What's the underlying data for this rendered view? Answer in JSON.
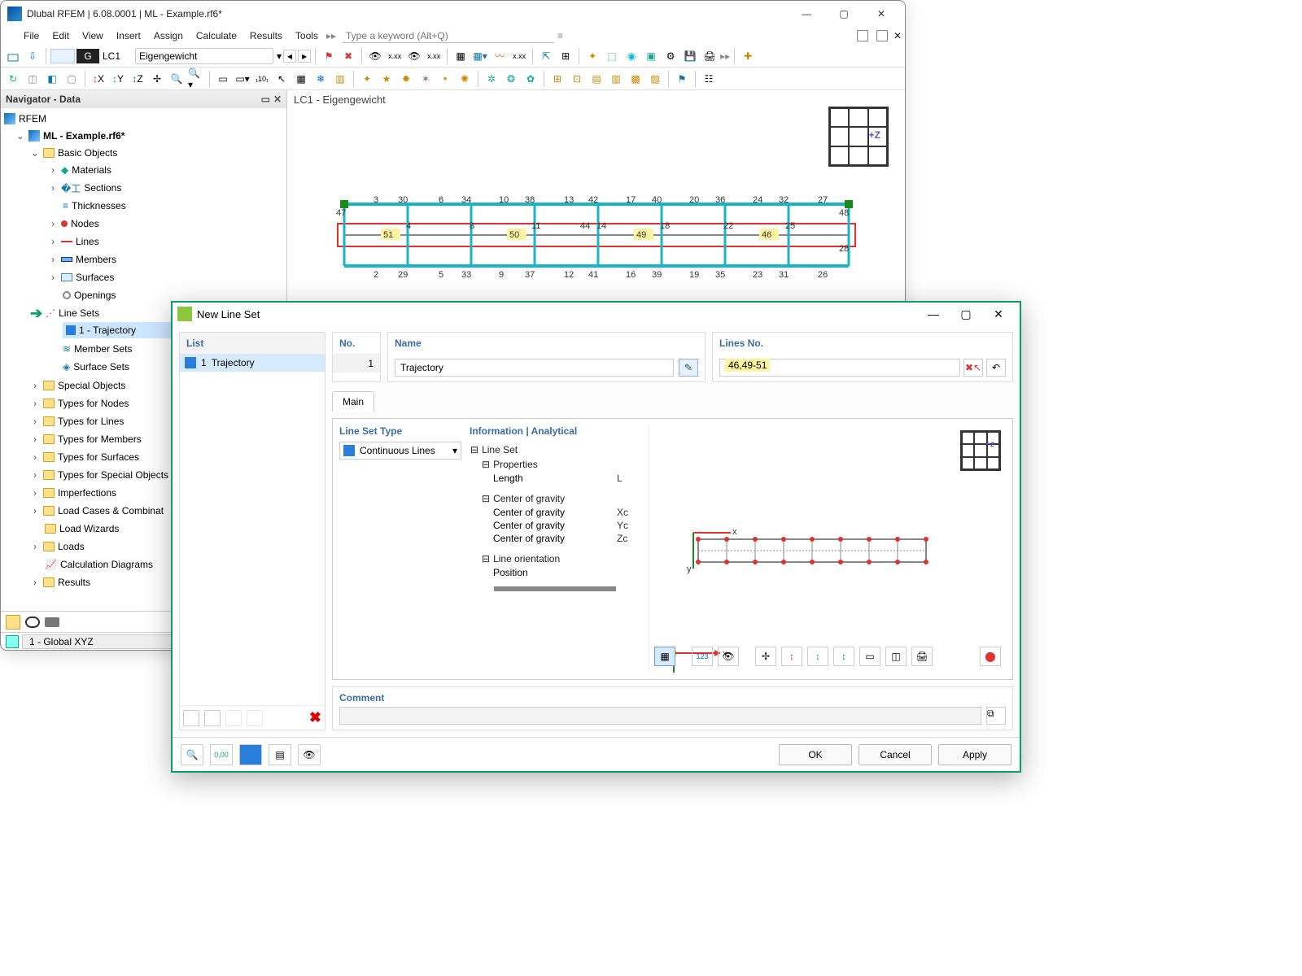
{
  "window": {
    "title": "Dlubal RFEM | 6.08.0001 | ML - Example.rf6*",
    "search_placeholder": "Type a keyword (Alt+Q)"
  },
  "menu": [
    "File",
    "Edit",
    "View",
    "Insert",
    "Assign",
    "Calculate",
    "Results",
    "Tools"
  ],
  "loadcase": {
    "g": "G",
    "lc": "LC1",
    "name": "Eigengewicht"
  },
  "navigator": {
    "title": "Navigator - Data",
    "root": "RFEM",
    "model": "ML - Example.rf6*",
    "basic": "Basic Objects",
    "items": [
      "Materials",
      "Sections",
      "Thicknesses",
      "Nodes",
      "Lines",
      "Members",
      "Surfaces",
      "Openings",
      "Line Sets",
      "Member Sets",
      "Surface Sets"
    ],
    "lineset_child": "1 - Trajectory",
    "special": "Special Objects",
    "types": [
      "Types for Nodes",
      "Types for Lines",
      "Types for Members",
      "Types for Surfaces",
      "Types for Special Objects",
      "Imperfections",
      "Load Cases & Combinat",
      "Load Wizards",
      "Loads",
      "Calculation Diagrams",
      "Results"
    ],
    "global": "1 - Global XYZ"
  },
  "viewport": {
    "title": "LC1 - Eigengewicht",
    "axis_label": "+Z"
  },
  "beam_nodes_top": [
    "3",
    "30",
    "6",
    "34",
    "10",
    "38",
    "13",
    "42",
    "17",
    "40",
    "20",
    "36",
    "24",
    "32",
    "27"
  ],
  "beam_row1_l": "47",
  "beam_row1_r": "48",
  "beam_row2": [
    "4",
    "8",
    "11",
    "44",
    "14",
    "18",
    "22",
    "25"
  ],
  "beam_members": [
    "51",
    "50",
    "49",
    "46"
  ],
  "beam_nodes_bot": [
    "2",
    "29",
    "5",
    "33",
    "9",
    "37",
    "12",
    "41",
    "16",
    "39",
    "19",
    "35",
    "23",
    "31",
    "26"
  ],
  "beam_row3_r": "28",
  "dialog": {
    "title": "New Line Set",
    "list_hdr": "List",
    "list_item_no": "1",
    "list_item_name": "Trajectory",
    "no_hdr": "No.",
    "no_val": "1",
    "name_hdr": "Name",
    "name_val": "Trajectory",
    "lines_hdr": "Lines No.",
    "lines_val": "46,49-51",
    "tab_main": "Main",
    "lst_hdr": "Line Set Type",
    "lst_val": "Continuous Lines",
    "info_hdr": "Information | Analytical",
    "info_group": "Line Set",
    "info_props": "Properties",
    "info_len": "Length",
    "info_len_s": "L",
    "info_cg": "Center of gravity",
    "info_cg_x": "Xc",
    "info_cg_y": "Yc",
    "info_cg_z": "Zc",
    "info_cgk": "Center of gravity",
    "info_lo": "Line orientation",
    "info_pos": "Position",
    "comment_hdr": "Comment",
    "ok": "OK",
    "cancel": "Cancel",
    "apply": "Apply",
    "axis_x": "x",
    "axis_y": "y",
    "mini_z": "+z"
  }
}
